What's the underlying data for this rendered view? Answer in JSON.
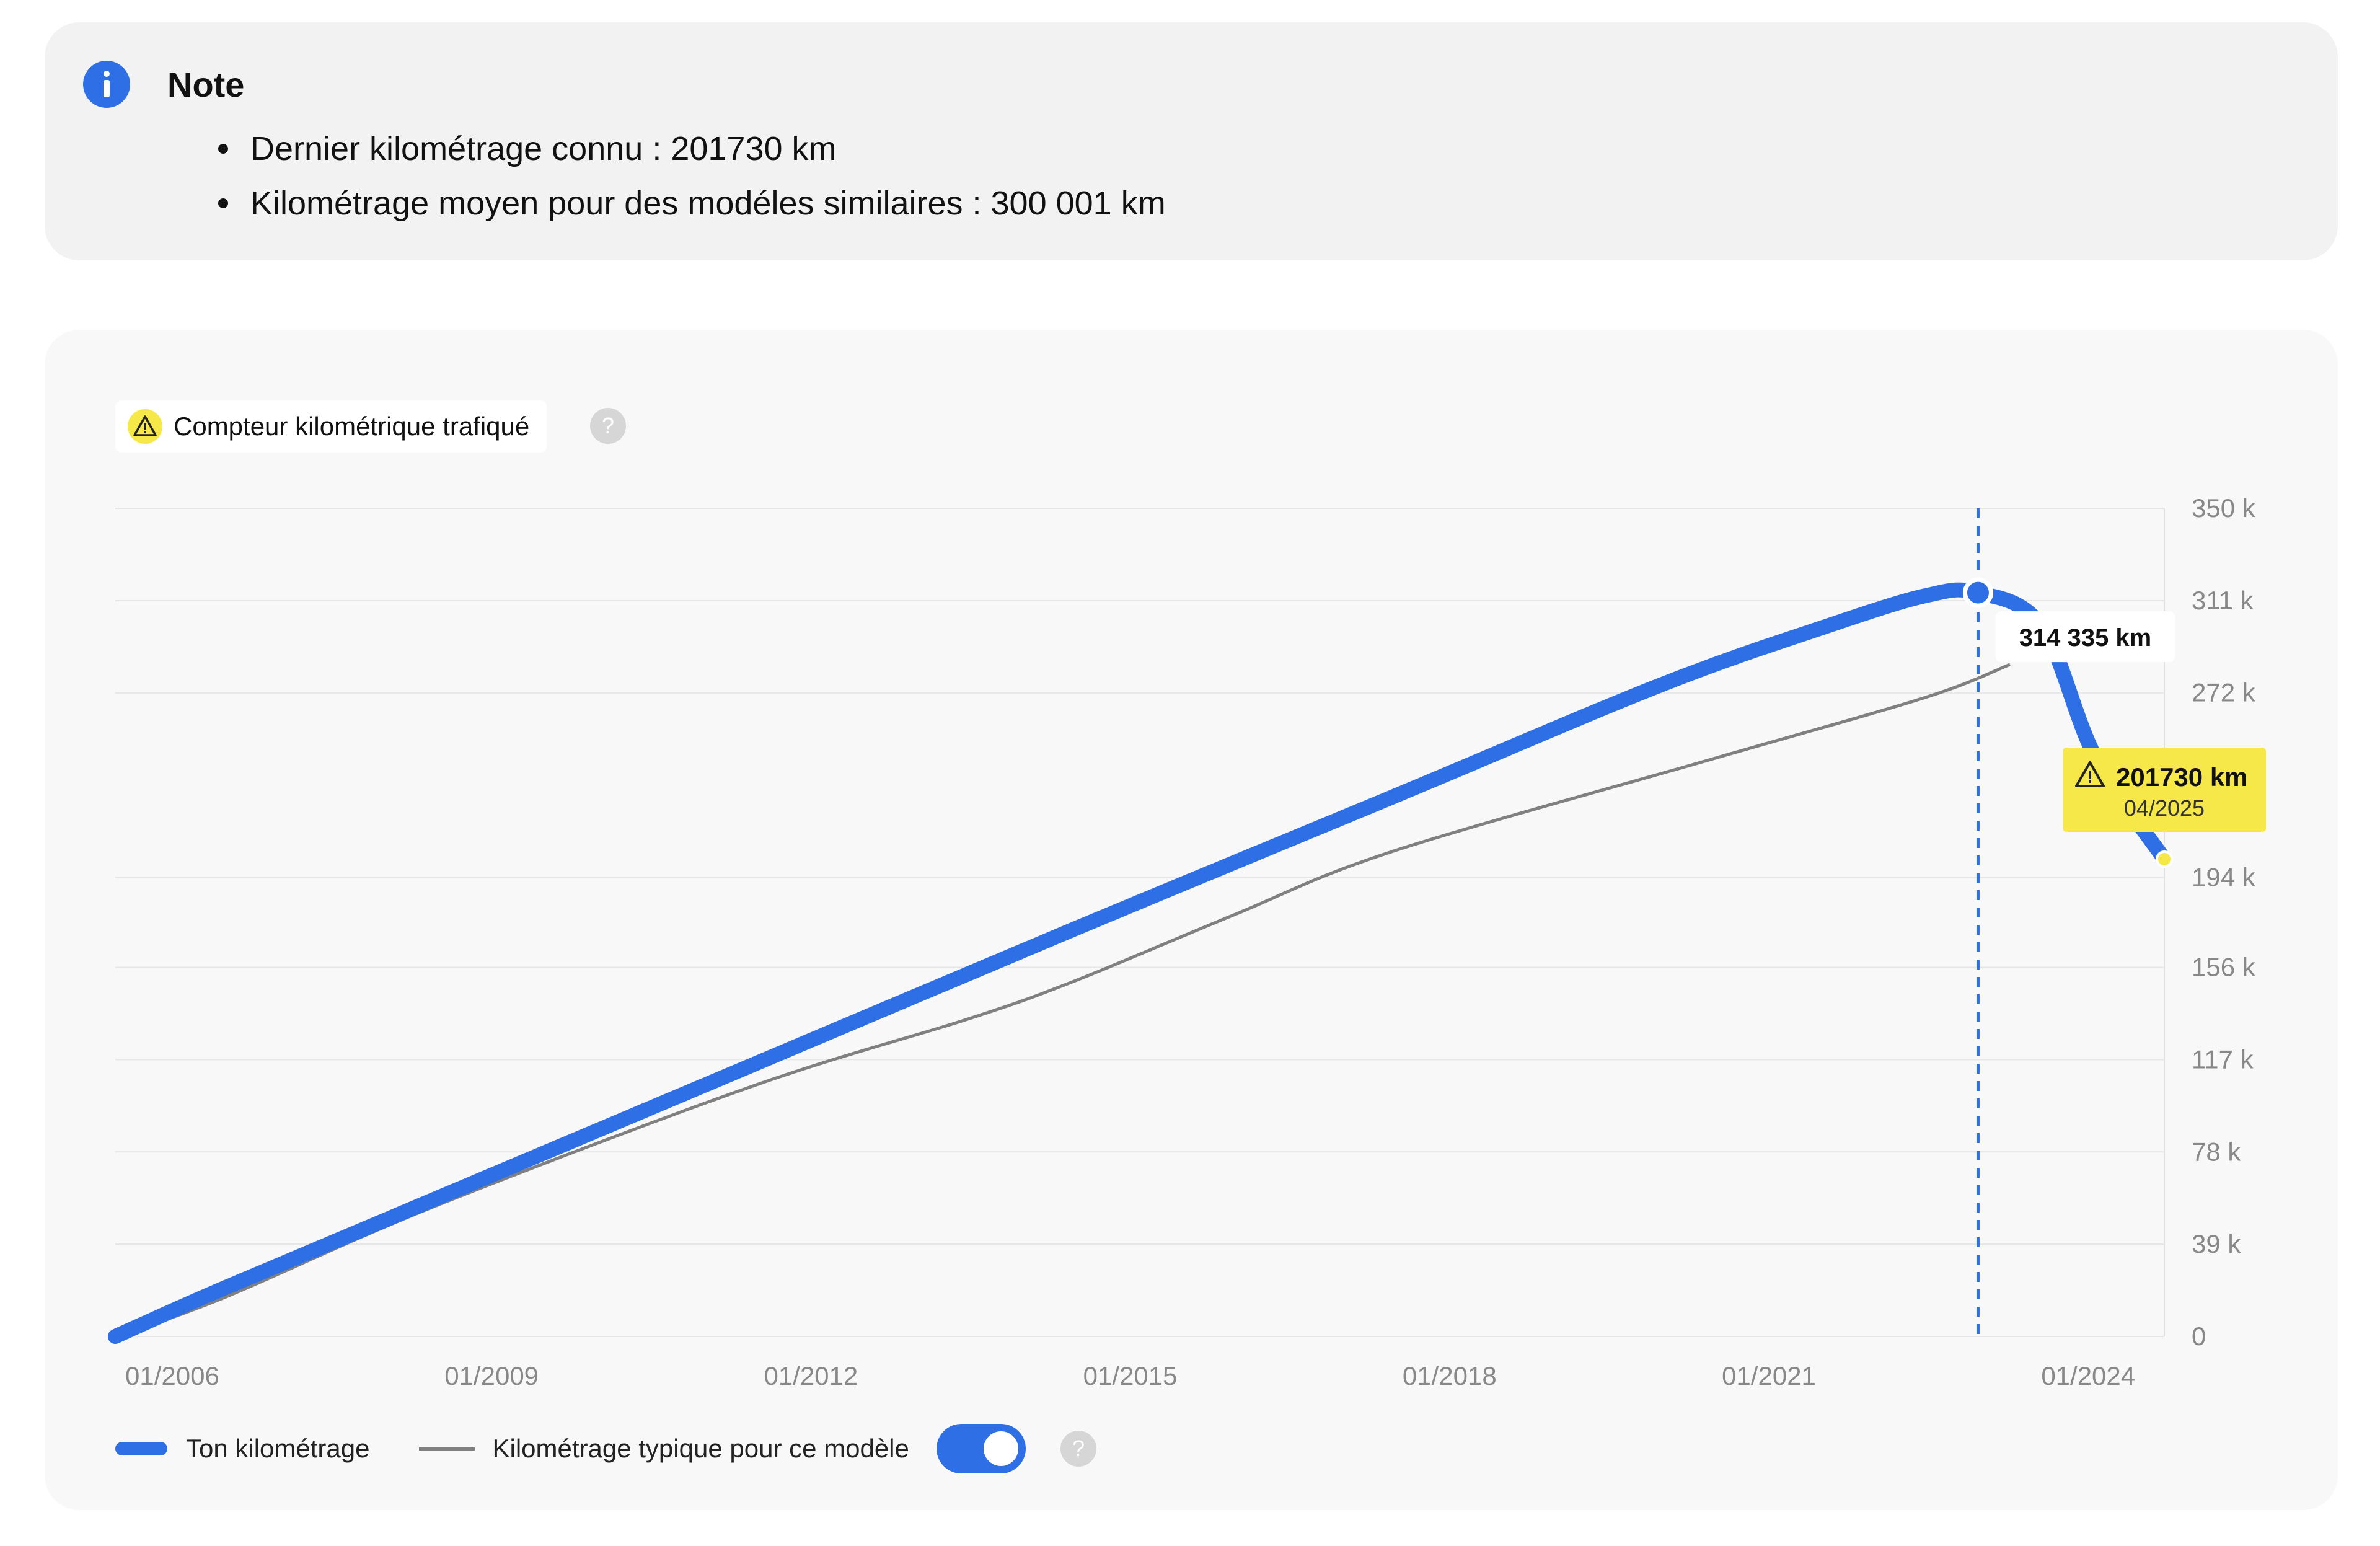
{
  "note": {
    "title": "Note",
    "items": [
      "Dernier kilométrage connu : 201730 km",
      "Kilométrage moyen pour des modéles similaires : 300 001 km"
    ],
    "icon": "info-icon",
    "accent": "#2f6fe6"
  },
  "badge": {
    "label": "Compteur kilométrique trafiqué",
    "icon": "warning-icon",
    "color": "#f7e84a"
  },
  "chart_data": {
    "type": "line",
    "xlim": [
      2006.0,
      2025.25
    ],
    "ylim": [
      0,
      350000
    ],
    "grid": true,
    "y_ticks": [
      "0",
      "39 k",
      "78 k",
      "117 k",
      "156 k",
      "194 k",
      "272 k",
      "311 k",
      "350 k"
    ],
    "y_tick_values": [
      0,
      39000,
      78000,
      117000,
      156000,
      194000,
      272000,
      311000,
      350000
    ],
    "x_ticks": [
      "01/2006",
      "01/2009",
      "01/2012",
      "01/2015",
      "01/2018",
      "01/2021",
      "01/2024"
    ],
    "x_tick_values": [
      2006,
      2009,
      2012,
      2015,
      2018,
      2021,
      2024
    ],
    "series": [
      {
        "name": "Ton kilométrage",
        "color": "#2f6fe6",
        "x": [
          2006.0,
          2007.0,
          2009.0,
          2012.0,
          2015.0,
          2018.0,
          2020.5,
          2022.0,
          2023.0,
          2023.5,
          2024.1,
          2024.6,
          2025.25
        ],
        "y": [
          0,
          20000,
          58000,
          115000,
          172000,
          228000,
          275000,
          299000,
          313000,
          314335,
          300000,
          245000,
          201730
        ]
      },
      {
        "name": "Kilométrage typique pour ce modèle",
        "color": "#808080",
        "x": [
          2006.0,
          2007.0,
          2009.0,
          2012.0,
          2014.0,
          2015.0,
          2016.5,
          2018.0,
          2021.0,
          2023.0,
          2023.8
        ],
        "y": [
          0,
          16000,
          55000,
          106000,
          134000,
          150000,
          178000,
          205000,
          244000,
          270000,
          284000
        ]
      }
    ],
    "marker": {
      "x": 2023.5,
      "label": "314 335 km"
    },
    "flag": {
      "x": 2025.25,
      "value": 201730,
      "label": "201730 km",
      "date": "04/2025",
      "color": "#f7e84a"
    }
  },
  "legend": {
    "series1": "Ton kilométrage",
    "series2": "Kilométrage typique pour ce modèle",
    "toggle_on": true
  }
}
